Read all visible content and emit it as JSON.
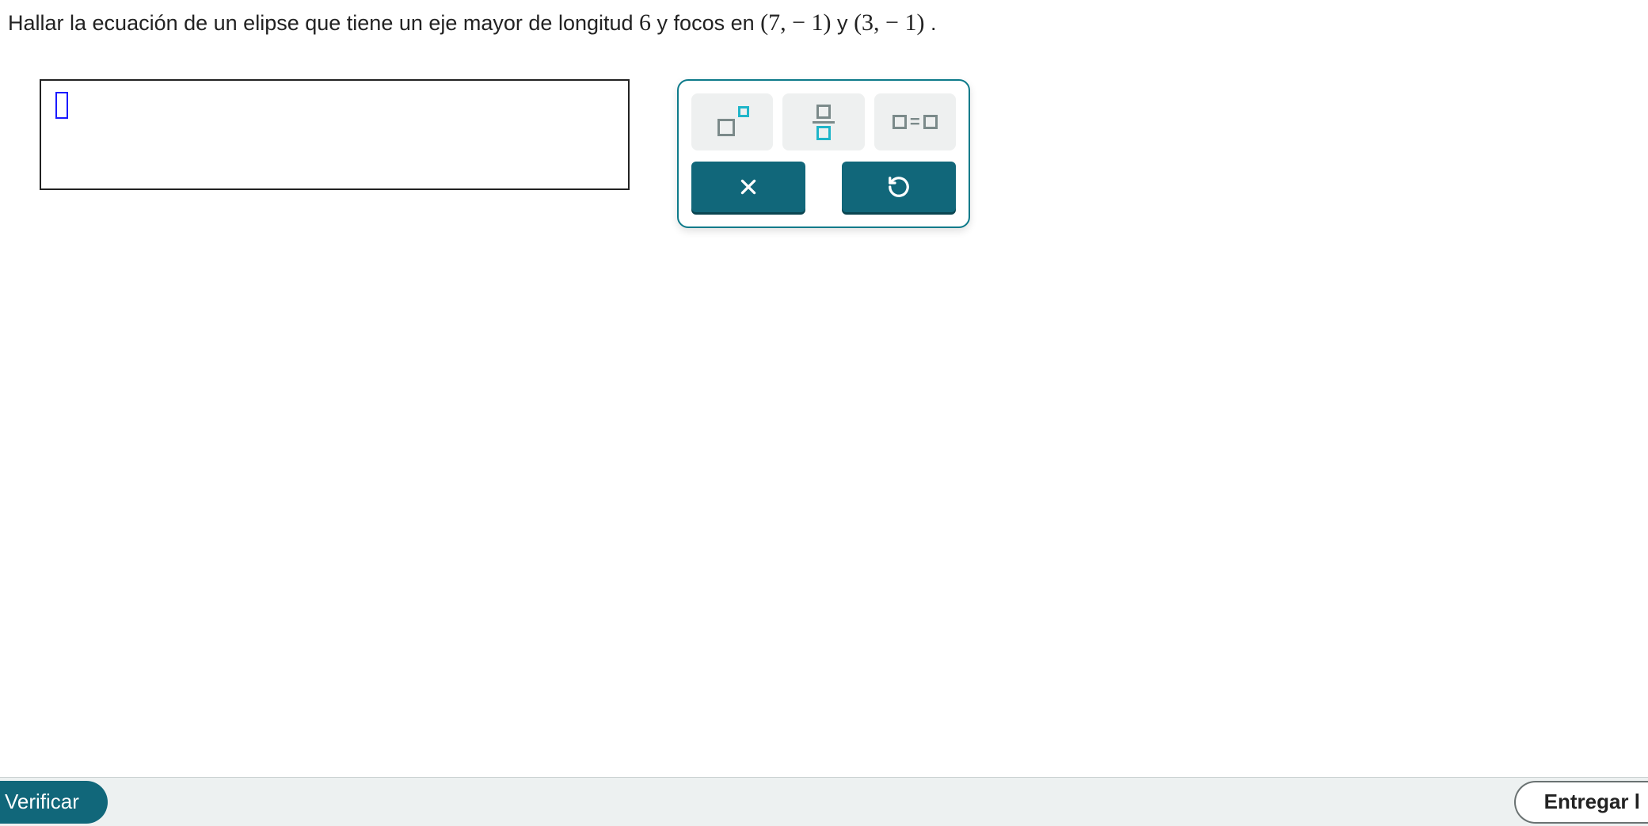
{
  "question": {
    "prefix": "Hallar la ecuación de un elipse que tiene un eje mayor de longitud ",
    "major_axis": "6",
    "mid1": " y focos en ",
    "focus1": "(7, − 1)",
    "mid2": " y ",
    "focus2": "(3, − 1)",
    "suffix": "."
  },
  "keypad": {
    "tools": {
      "exponent": "exponent",
      "fraction": "fraction",
      "equation": "equation"
    },
    "actions": {
      "clear": "clear",
      "undo": "undo"
    }
  },
  "footer": {
    "verify": "Verificar",
    "submit": "Entregar l"
  }
}
